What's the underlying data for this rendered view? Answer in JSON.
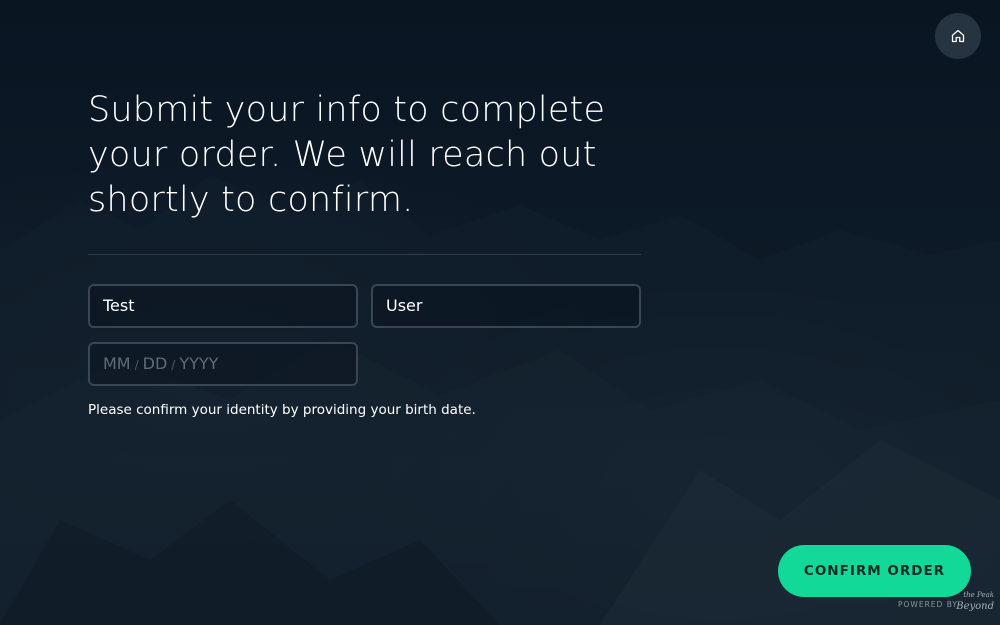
{
  "header": {
    "home_icon": "home-icon"
  },
  "main": {
    "headline": "Submit your info to complete your order. We will reach out shortly to confirm."
  },
  "form": {
    "first_name_value": "Test",
    "last_name_value": "User",
    "birthdate": {
      "month_placeholder": "MM",
      "day_placeholder": "DD",
      "year_placeholder": "YYYY",
      "separator": "/"
    },
    "helper_text": "Please confirm your identity by providing your birth date."
  },
  "footer": {
    "confirm_label": "CONFIRM ORDER",
    "powered_by": "POWERED BY",
    "brand_logo_text": "the Peak Beyond"
  },
  "colors": {
    "accent": "#12d898",
    "background": "#0d1a27",
    "field_border": "#3a4652"
  }
}
